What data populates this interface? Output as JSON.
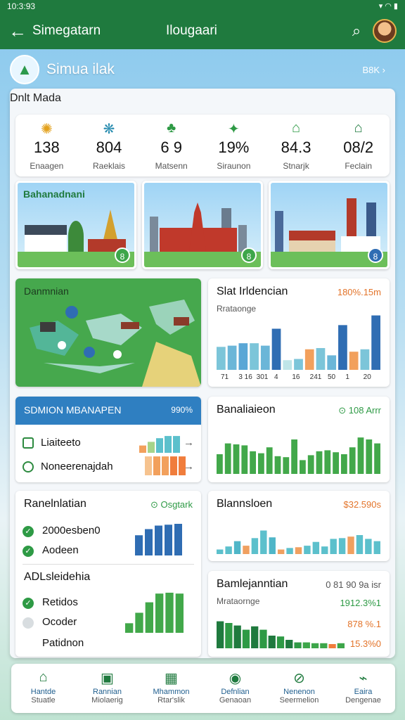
{
  "status": {
    "time": "10:3:93",
    "icons": "▾ ◠ ▮"
  },
  "appbar": {
    "back": "←",
    "title_left": "Simegatarn",
    "title_center": "Ilougaari",
    "search": "⌕"
  },
  "header": {
    "title": "Simua ilak",
    "link": "B8K",
    "chev": "›"
  },
  "panel": {
    "title": "Dnlt Mada"
  },
  "stats": [
    {
      "icon": "✺",
      "icon_color": "#e3a11c",
      "value": "138",
      "label": "Enaagen"
    },
    {
      "icon": "❋",
      "icon_color": "#2a8db0",
      "value": "804",
      "label": "Raeklais"
    },
    {
      "icon": "♣",
      "icon_color": "#2e9a45",
      "value": "6 9",
      "label": "Matsenn"
    },
    {
      "icon": "✦",
      "icon_color": "#2e9a45",
      "value": "19%",
      "label": "Siraunon"
    },
    {
      "icon": "⌂",
      "icon_color": "#2e9a45",
      "value": "84.3",
      "label": "Stnarjk"
    },
    {
      "icon": "⌂",
      "icon_color": "#1f7a3e",
      "value": "08/2",
      "label": "Feclain"
    }
  ],
  "photos": [
    {
      "caption": "Bahanadnani",
      "badge": "8"
    },
    {
      "caption": "",
      "badge": "8"
    },
    {
      "caption": "",
      "badge": "8"
    }
  ],
  "map": {
    "title": "Danmnian"
  },
  "chart1": {
    "title": "Slat Irldencian",
    "value": "180%.15m",
    "subtitle": "Rrataonge",
    "tick_labels": [
      "71",
      "3 16",
      "301",
      "4",
      "16",
      "241",
      "50",
      "1",
      "20"
    ]
  },
  "list_card": {
    "header": "SDMION MBANAPEN",
    "header_value": "990%",
    "rows": [
      {
        "label": "Liaiteeto",
        "chev": "→"
      },
      {
        "label": "Noneerenajdah",
        "chev": "→"
      }
    ]
  },
  "chart2": {
    "title": "Banaliaieon",
    "value": "⊙ 108 Arrr"
  },
  "status_card": {
    "title": "Ranelnlatian",
    "value": "⊙ Osgtark",
    "items": [
      {
        "label": "2000esben0",
        "checked": true
      },
      {
        "label": "Aodeen",
        "checked": true
      }
    ],
    "section_title": "ADLsleidehia",
    "items2": [
      {
        "label": "Retidos",
        "checked": true
      },
      {
        "label": "Ocoder",
        "checked": false
      },
      {
        "label": "Patidnon",
        "checked": null
      }
    ]
  },
  "chart3": {
    "title": "Blannsloen",
    "value": "$32.590s"
  },
  "chart4": {
    "title": "Bamlejanntian",
    "value": "0 81 90 9a isr",
    "subtitle": "Mrataornge",
    "legend": [
      "1912.3%1",
      "878 %.1",
      "15.3%0"
    ]
  },
  "nav": [
    {
      "icon": "⌂",
      "l1": "Hantde",
      "l2": "Stuatle"
    },
    {
      "icon": "▣",
      "l1": "Rannian",
      "l2": "Miolaerig"
    },
    {
      "icon": "▦",
      "l1": "Mhammon",
      "l2": "Rtar'slik"
    },
    {
      "icon": "◉",
      "l1": "Defnlian",
      "l2": "Genaoan"
    },
    {
      "icon": "⊘",
      "l1": "Nenenon",
      "l2": "Seermelion"
    },
    {
      "icon": "⌁",
      "l1": "Eaira",
      "l2": "Dengenae"
    }
  ],
  "chart_data": [
    {
      "type": "bar",
      "title": "Slat Irldencian",
      "categories": [
        "71",
        "3 16",
        "301",
        "4",
        "16",
        "241",
        "50",
        "1",
        "20"
      ],
      "values": [
        38,
        40,
        44,
        44,
        40,
        68,
        16,
        18,
        34,
        36,
        24,
        74,
        30,
        34,
        90
      ],
      "colors": [
        "#7cc5d9",
        "#6bb6d8",
        "#5aa7d6",
        "#7cc5d9",
        "#6bb6d8",
        "#2f6db3",
        "#bfe5e8",
        "#7cc5d9",
        "#f2a05c",
        "#7cc5d9",
        "#6bb6d8",
        "#2f6db3",
        "#f2a05c",
        "#7cc5d9",
        "#2f6db3"
      ],
      "ylim": [
        0,
        100
      ]
    },
    {
      "type": "bar",
      "title": "Banaliaieon",
      "values": [
        40,
        62,
        60,
        58,
        46,
        42,
        54,
        36,
        34,
        70,
        28,
        38,
        46,
        48,
        44,
        40,
        54,
        74,
        70,
        62
      ],
      "color": "#42a84a",
      "ylim": [
        0,
        100
      ]
    },
    {
      "type": "bar",
      "title": "Blannsloen",
      "values": [
        12,
        20,
        34,
        22,
        42,
        62,
        44,
        12,
        16,
        18,
        22,
        32,
        20,
        40,
        42,
        46,
        50,
        40,
        34
      ],
      "colors": [
        "#5cc0cc",
        "#5cc0cc",
        "#4fb6c8",
        "#f0a060",
        "#5cc0cc",
        "#5cc0cc",
        "#4fb6c8",
        "#f0a060",
        "#5cc0cc",
        "#f0a060",
        "#5cc0cc",
        "#5cc0cc",
        "#5cc0cc",
        "#5cc0cc",
        "#5cc0cc",
        "#f0a060",
        "#5cc0cc",
        "#5cc0cc",
        "#5cc0cc"
      ],
      "ylim": [
        0,
        100
      ]
    },
    {
      "type": "bar",
      "title": "Bamlejanntian",
      "values": [
        64,
        60,
        54,
        44,
        52,
        44,
        30,
        28,
        20,
        14,
        14,
        12,
        12,
        10,
        12
      ],
      "colors": [
        "#1f7a3e",
        "#2e9a45",
        "#1f7a3e",
        "#2e9a45",
        "#1f7a3e",
        "#2e9a45",
        "#1f7a3e",
        "#2e9a45",
        "#1f7a3e",
        "#2e9a45",
        "#3da64a",
        "#3da64a",
        "#3da64a",
        "#f07d3c",
        "#3da64a"
      ],
      "ylim": [
        0,
        100
      ]
    },
    {
      "type": "bar",
      "title": "Liaiteeto",
      "values": [
        20,
        30,
        40,
        46,
        46
      ],
      "colors": [
        "#f2a05c",
        "#a6d48a",
        "#5cc0cc",
        "#5cc0cc",
        "#5cc0cc"
      ],
      "ylim": [
        0,
        50
      ]
    },
    {
      "type": "bar",
      "title": "Noneerenajdah",
      "values": [
        48,
        48,
        48,
        48,
        48
      ],
      "colors": [
        "#f6c38f",
        "#f2a05c",
        "#f2a05c",
        "#f07d3c",
        "#f07d3c"
      ],
      "ylim": [
        0,
        50
      ]
    },
    {
      "type": "bar",
      "title": "Ranelnlatian",
      "values": [
        46,
        60,
        68,
        70,
        72
      ],
      "color": "#2f6db3",
      "ylim": [
        0,
        80
      ]
    },
    {
      "type": "bar",
      "title": "ADLsleidehia",
      "values": [
        22,
        46,
        70,
        90,
        92,
        90
      ],
      "color": "#42a84a",
      "ylim": [
        0,
        100
      ]
    }
  ]
}
